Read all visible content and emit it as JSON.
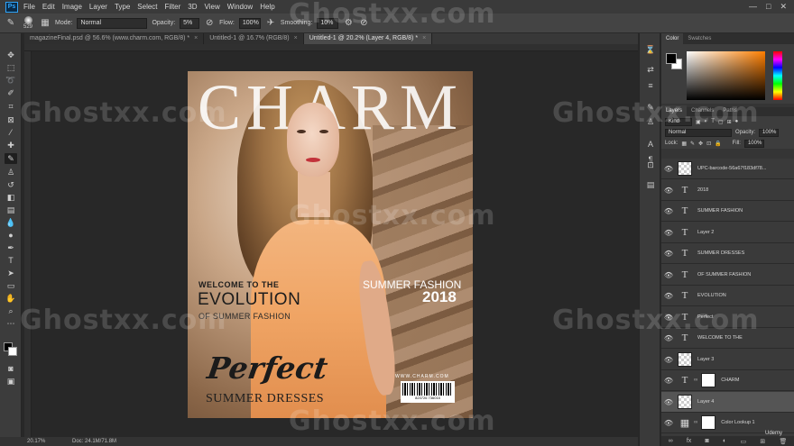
{
  "app": {
    "logo": "Ps",
    "menu": [
      "File",
      "Edit",
      "Image",
      "Layer",
      "Type",
      "Select",
      "Filter",
      "3D",
      "View",
      "Window",
      "Help"
    ],
    "window_controls": [
      "—",
      "□",
      "✕"
    ]
  },
  "options": {
    "brush_size": "529",
    "mode_label": "Mode:",
    "mode_value": "Normal",
    "opacity_label": "Opacity:",
    "opacity_value": "5%",
    "flow_label": "Flow:",
    "flow_value": "100%",
    "smoothing_label": "Smoothing:",
    "smoothing_value": "10%"
  },
  "tabs": [
    {
      "label": "magazineFinal.psd @ 56.6% (www.charm.com, RGB/8) *",
      "active": false
    },
    {
      "label": "Untitled-1 @ 16.7% (RGB/8)",
      "active": false
    },
    {
      "label": "Untitled-1 @ 20.2% (Layer 4, RGB/8) *",
      "active": true
    }
  ],
  "status": {
    "zoom": "20.17%",
    "doc": "Doc: 24.1M/71.8M"
  },
  "cover": {
    "title": "CHARM",
    "welcome": "WELCOME TO THE",
    "evolution": "EVOLUTION",
    "of_summer": "OF SUMMER FASHION",
    "summer_fashion": "SUMMER FASHION",
    "year": "2018",
    "perfect": "Perfect",
    "summer_dresses": "SUMMER DRESSES",
    "url": "WWW.CHARM.COM",
    "barcode_number": "823726 736015"
  },
  "color_panel": {
    "tabs": [
      "Color",
      "Swatches"
    ]
  },
  "layers_panel": {
    "tabs": [
      "Layers",
      "Channels",
      "Paths"
    ],
    "kind_label": "Kind",
    "blend_mode": "Normal",
    "opacity_label": "Opacity:",
    "opacity_value": "100%",
    "lock_label": "Lock:",
    "fill_label": "Fill:",
    "fill_value": "100%",
    "layers": [
      {
        "name": "UPC-barcode-56a67f183df78...",
        "thumb": "checker"
      },
      {
        "name": "2018",
        "thumb": "type"
      },
      {
        "name": "SUMMER FASHION",
        "thumb": "type"
      },
      {
        "name": "Layer 2",
        "thumb": "type"
      },
      {
        "name": "SUMMER DRESSES",
        "thumb": "type"
      },
      {
        "name": "OF SUMMER FASHION",
        "thumb": "type"
      },
      {
        "name": "EVOLUTION",
        "thumb": "type"
      },
      {
        "name": "Perfect",
        "thumb": "type"
      },
      {
        "name": "WELCOME TO THE",
        "thumb": "type"
      },
      {
        "name": "Layer 3",
        "thumb": "checker"
      },
      {
        "name": "CHARM",
        "thumb": "type-mask"
      },
      {
        "name": "Layer 4",
        "thumb": "checker",
        "active": true
      },
      {
        "name": "Color Lookup 1",
        "thumb": "adjust-mask"
      }
    ]
  },
  "watermark": "Ghostxx.com",
  "udemy": "Udemy"
}
